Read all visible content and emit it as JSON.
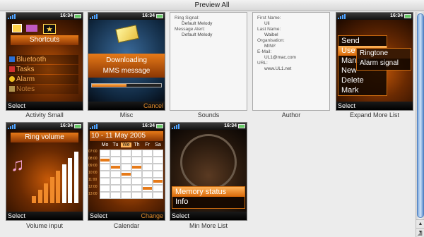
{
  "window": {
    "title": "Preview All"
  },
  "phone_status": {
    "clock": "16:34"
  },
  "thumbnails": {
    "activity_small": {
      "caption": "Activity Small",
      "heading": "Shortcuts",
      "items": [
        "Bluetooth",
        "Tasks",
        "Alarm",
        "Notes"
      ],
      "left_soft": "Select"
    },
    "misc": {
      "caption": "Misc",
      "message_line1": "Downloading",
      "message_line2": "MMS message",
      "right_soft": "Cancel",
      "progress": 0.5
    },
    "sounds": {
      "caption": "Sounds",
      "fields": [
        {
          "label": "Ring Signal:",
          "value": "Default Melody"
        },
        {
          "label": "Message Alert:",
          "value": "Default Melody"
        }
      ]
    },
    "author": {
      "caption": "Author",
      "fields": [
        {
          "label": "First Name:",
          "value": "Uli"
        },
        {
          "label": "Last Name:",
          "value": "Waibel"
        },
        {
          "label": "Organisation:",
          "value": "MINI²"
        },
        {
          "label": "E-Mail:",
          "value": "UL1@mac.com"
        },
        {
          "label": "URL:",
          "value": "www.UL1.net"
        }
      ]
    },
    "expand_more_list": {
      "caption": "Expand More List",
      "items": [
        "Send",
        "Use as",
        "Manage",
        "New",
        "Delete",
        "Mark"
      ],
      "submenu": [
        "Ringtone",
        "Alarm signal"
      ],
      "left_soft": "Select"
    },
    "volume_input": {
      "caption": "Volume input",
      "heading": "Ring volume",
      "left_soft": "Select",
      "level": 0.6
    },
    "calendar": {
      "caption": "Calendar",
      "heading": "10 - 11 May 2005",
      "days": [
        "Mo",
        "Tu",
        "We",
        "Th",
        "Fr",
        "Sa"
      ],
      "hours": [
        "07:00",
        "08:00",
        "09:00",
        "10:00",
        "11:00",
        "12:00",
        "13:00"
      ],
      "left_soft": "Select",
      "right_soft": "Change"
    },
    "min_more_list": {
      "caption": "Min More List",
      "items": [
        "Memory status",
        "Info"
      ],
      "left_soft": "Select"
    }
  },
  "colors": {
    "accent": "#e67a18",
    "dark": "#1a0800",
    "scroll": "#6f9fdc"
  }
}
